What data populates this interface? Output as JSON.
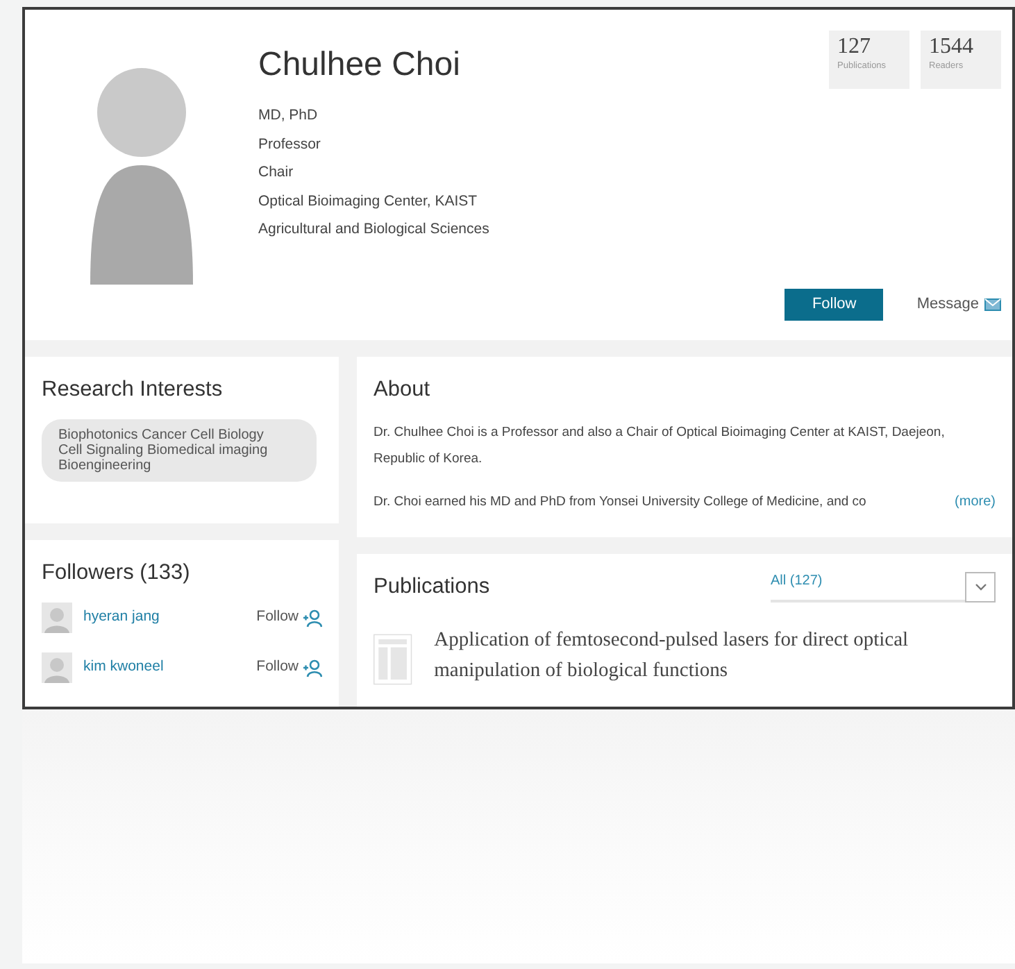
{
  "profile": {
    "name": "Chulhee Choi",
    "credentials": [
      "MD, PhD",
      "Professor",
      "Chair",
      "Optical Bioimaging Center, KAIST",
      "Agricultural and Biological Sciences"
    ],
    "stats": [
      {
        "value": "127",
        "label": "Publications"
      },
      {
        "value": "1544",
        "label": "Readers"
      }
    ],
    "follow_button": "Follow",
    "message_link": "Message"
  },
  "research_interests": {
    "title": "Research Interests",
    "tags": [
      "Biophotonics",
      "Cancer Cell Biology",
      "Cell Signaling",
      "Biomedical imaging",
      "Bioengineering"
    ]
  },
  "followers": {
    "title": "Followers (133)",
    "items": [
      {
        "name": "hyeran jang",
        "action": "Follow"
      },
      {
        "name": "kim kwoneel",
        "action": "Follow"
      }
    ]
  },
  "about": {
    "title": "About",
    "paragraphs": [
      "Dr. Chulhee Choi is a Professor and also a Chair of Optical Bioimaging Center at KAIST, Daejeon, Republic of Korea.",
      "Dr. Choi earned his MD and PhD from Yonsei University College of Medicine, and co"
    ],
    "more": "(more)"
  },
  "publications": {
    "title": "Publications",
    "filter": "All (127)",
    "items": [
      {
        "title": "Application of femtosecond-pulsed lasers for direct optical manipulation of biological functions"
      }
    ]
  }
}
